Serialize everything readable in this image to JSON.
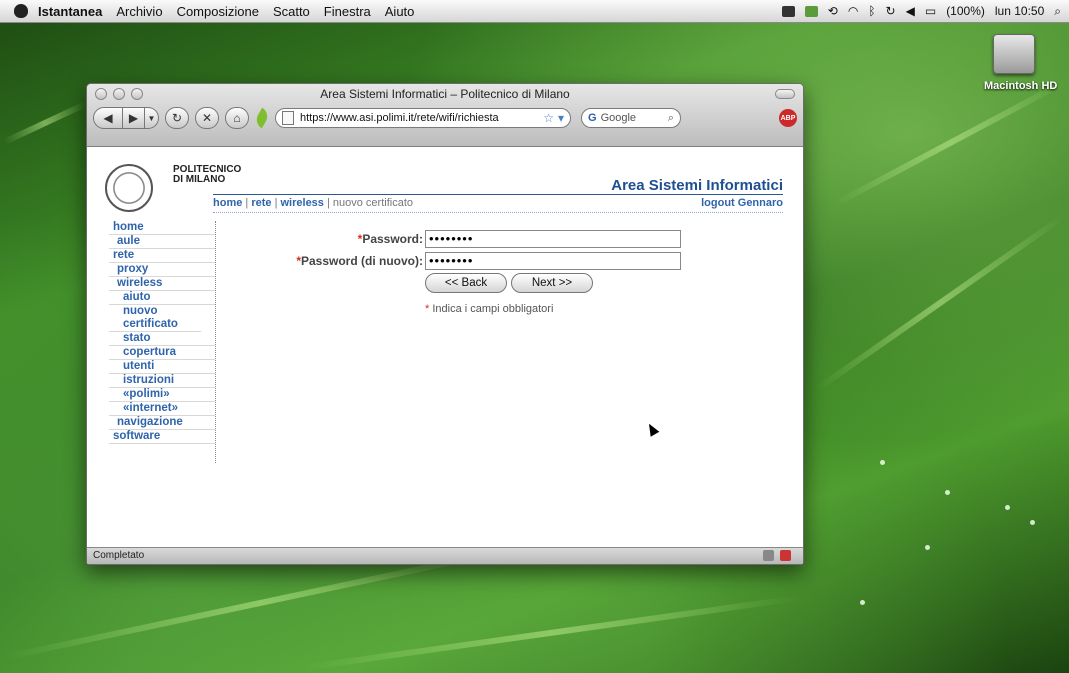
{
  "menubar": {
    "app_name": "Istantanea",
    "items": [
      "Archivio",
      "Composizione",
      "Scatto",
      "Finestra",
      "Aiuto"
    ],
    "battery": "(100%)",
    "clock": "lun 10:50"
  },
  "desktop": {
    "disk_label": "Macintosh HD"
  },
  "browser": {
    "window_title": "Area Sistemi Informatici – Politecnico di Milano",
    "url": "https://www.asi.polimi.it/rete/wifi/richiesta",
    "search_placeholder": "Google",
    "status_text": "Completato"
  },
  "page": {
    "logo_text_line1": "POLITECNICO",
    "logo_text_line2": "DI MILANO",
    "header_title": "Area Sistemi Informatici",
    "breadcrumb": {
      "home": "home",
      "rete": "rete",
      "wireless": "wireless",
      "current": "nuovo certificato",
      "sep": "|"
    },
    "logout": "logout Gennaro",
    "sidebar": [
      {
        "label": "home",
        "level": 1
      },
      {
        "label": "aule",
        "level": 2
      },
      {
        "label": "rete",
        "level": 1
      },
      {
        "label": "proxy",
        "level": 2
      },
      {
        "label": "wireless",
        "level": 2
      },
      {
        "label": "aiuto",
        "level": 3
      },
      {
        "label": "nuovo certificato",
        "level": 3
      },
      {
        "label": "stato",
        "level": 3
      },
      {
        "label": "copertura",
        "level": 3
      },
      {
        "label": "utenti",
        "level": 3
      },
      {
        "label": "istruzioni",
        "level": 3
      },
      {
        "label": "«polimi»",
        "level": 3
      },
      {
        "label": "«internet»",
        "level": 3
      },
      {
        "label": "navigazione",
        "level": 2
      },
      {
        "label": "software",
        "level": 1
      }
    ],
    "form": {
      "required_mark": "*",
      "password_label": "Password:",
      "password_value": "••••••••",
      "password_again_label": "Password (di nuovo):",
      "password_again_value": "••••••••",
      "back_label": "<< Back",
      "next_label": "Next >>",
      "required_note": "Indica i campi obbligatori"
    }
  }
}
